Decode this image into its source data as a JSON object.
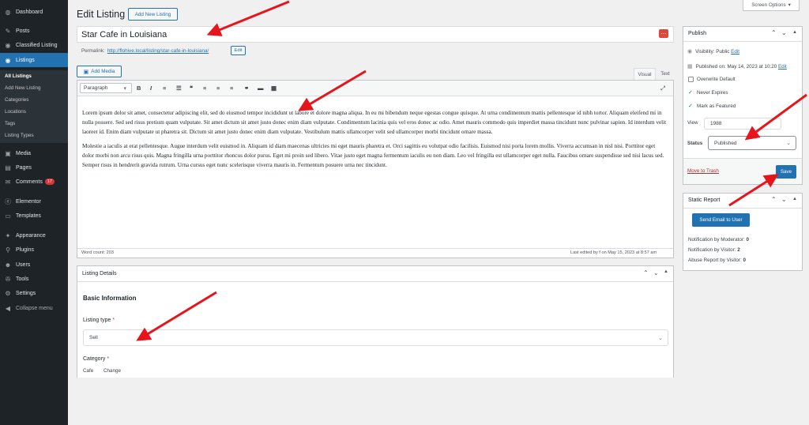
{
  "sidebar": {
    "items": [
      {
        "label": "Dashboard",
        "icon": "dashboard-icon",
        "glyph": "◍"
      },
      {
        "label": "Posts",
        "icon": "pin-icon",
        "glyph": "✎"
      },
      {
        "label": "Classified Listing",
        "icon": "classified-icon",
        "glyph": "◉"
      },
      {
        "label": "Listings",
        "icon": "listings-icon",
        "glyph": "◉"
      },
      {
        "label": "Media",
        "icon": "media-icon",
        "glyph": "▣"
      },
      {
        "label": "Pages",
        "icon": "pages-icon",
        "glyph": "▤"
      },
      {
        "label": "Comments",
        "icon": "comments-icon",
        "glyph": "✉",
        "badge": "17"
      },
      {
        "label": "Elementor",
        "icon": "elementor-icon",
        "glyph": "ⓔ"
      },
      {
        "label": "Templates",
        "icon": "templates-icon",
        "glyph": "▭"
      },
      {
        "label": "Appearance",
        "icon": "appearance-icon",
        "glyph": "✦"
      },
      {
        "label": "Plugins",
        "icon": "plugins-icon",
        "glyph": "⚲"
      },
      {
        "label": "Users",
        "icon": "users-icon",
        "glyph": "☻"
      },
      {
        "label": "Tools",
        "icon": "tools-icon",
        "glyph": "✇"
      },
      {
        "label": "Settings",
        "icon": "settings-icon",
        "glyph": "⚙"
      },
      {
        "label": "Collapse menu",
        "icon": "collapse-icon",
        "glyph": "◀"
      }
    ],
    "submenu": [
      "All Listings",
      "Add New Listing",
      "Categories",
      "Locations",
      "Tags",
      "Listing Types"
    ]
  },
  "header": {
    "title": "Edit Listing",
    "add_new": "Add New Listing",
    "screen_options": "Screen Options"
  },
  "post": {
    "title": "Star Cafe in Louisiana",
    "permalink_label": "Permalink:",
    "permalink_url": "http://flohive.local/listing/star-cafe-in-louisiana/",
    "edit": "Edit"
  },
  "editor": {
    "add_media": "Add Media",
    "tab_visual": "Visual",
    "tab_text": "Text",
    "format": "Paragraph",
    "toolbar": [
      {
        "name": "bold-icon",
        "glyph": "B"
      },
      {
        "name": "italic-icon",
        "glyph": "I"
      },
      {
        "name": "bullet-list-icon",
        "glyph": "≡"
      },
      {
        "name": "numbered-list-icon",
        "glyph": "☰"
      },
      {
        "name": "blockquote-icon",
        "glyph": "❝"
      },
      {
        "name": "align-left-icon",
        "glyph": "≡"
      },
      {
        "name": "align-center-icon",
        "glyph": "≡"
      },
      {
        "name": "align-right-icon",
        "glyph": "≡"
      },
      {
        "name": "link-icon",
        "glyph": "⚭"
      },
      {
        "name": "more-icon",
        "glyph": "▬"
      },
      {
        "name": "toolbar-toggle-icon",
        "glyph": "▦"
      }
    ],
    "paragraph1": "Lorem ipsum dolor sit amet, consectetur adipiscing elit, sed do eiusmod tempor incididunt ut labore et dolore magna aliqua. In eu mi bibendum neque egestas congue quisque. At urna condimentum mattis pellentesque id nibh tortor. Aliquam eleifend mi in nulla posuere. Sed sed risus pretium quam vulputate. Sit amet dictum sit amet justo donec enim diam vulputate. Condimentum lacinia quis vel eros donec ac odio. Amet mauris commodo quis imperdiet massa tincidunt nunc pulvinar sapien. Id interdum velit laoreet id. Enim diam vulputate ut pharetra sit. Dictum sit amet justo donec enim diam vulputate. Vestibulum mattis ullamcorper velit sed ullamcorper morbi tincidunt ornare massa.",
    "paragraph2": "Molestie a iaculis at erat pellentesque. Augue interdum velit euismod in. Aliquam id diam maecenas ultricies mi eget mauris pharetra et. Orci sagittis eu volutpat odio facilisis. Euismod nisi porta lorem mollis. Viverra accumsan in nisl nisi. Porttitor eget dolor morbi non arcu risus quis. Magna fringilla urna porttitor rhoncus dolor purus. Eget mi proin sed libero. Vitae justo eget magna fermentum iaculis eu non diam. Leo vel fringilla est ullamcorper eget nulla. Faucibus ornare suspendisse sed nisi lacus sed. Semper risus in hendrerit gravida rutrum. Urna cursus eget nunc scelerisque viverra mauris in. Fermentum posuere urna nec tincidunt.",
    "word_count": "Word count: 203",
    "last_edited": "Last edited by f on May 15, 2023 at 8:57 am"
  },
  "listing_details": {
    "title": "Listing Details",
    "section": "Basic Information",
    "type_label": "Listing type",
    "required": "*",
    "type_value": "Sell",
    "category_label": "Category",
    "category_value": "Cafe",
    "change": "Change"
  },
  "publish": {
    "title": "Publish",
    "visibility_label": "Visibility:",
    "visibility_value": "Public",
    "edit": "Edit",
    "published_on": "Published on: May 14, 2023 at 10:20",
    "overwrite_default": "Overwrite Default",
    "never_expires": "Never Expires",
    "mark_featured": "Mark as Featured",
    "view_label": "View",
    "view_value": "1988",
    "status_label": "Status",
    "status_value": "Published",
    "trash": "Move to Trash",
    "save": "Save"
  },
  "static_report": {
    "title": "Static Report",
    "send_email": "Send Email to User",
    "moderator_label": "Notification by Moderator:",
    "moderator_value": "0",
    "visitor_label": "Notification by Visitor:",
    "visitor_value": "2",
    "abuse_label": "Abuse Report by Visitor:",
    "abuse_value": "0"
  },
  "colors": {
    "sidebar": "#1d2327",
    "accent": "#2271b1",
    "arrow": "#e8141b"
  }
}
